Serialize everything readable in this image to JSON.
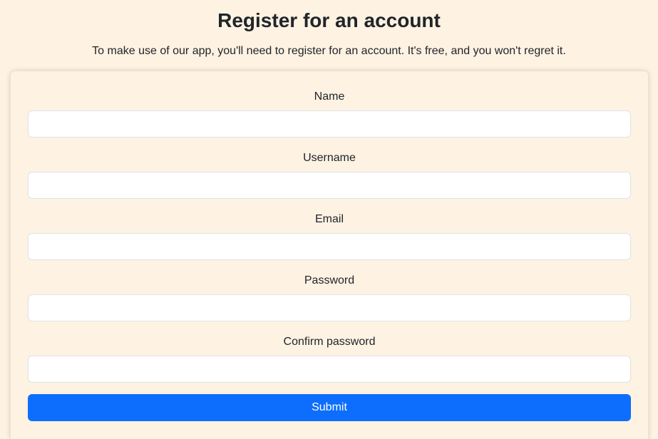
{
  "page": {
    "title": "Register for an account",
    "subtitle": "To make use of our app, you'll need to register for an account. It's free, and you won't regret it."
  },
  "form": {
    "fields": [
      {
        "label": "Name",
        "value": "",
        "placeholder": ""
      },
      {
        "label": "Username",
        "value": "",
        "placeholder": ""
      },
      {
        "label": "Email",
        "value": "",
        "placeholder": ""
      },
      {
        "label": "Password",
        "value": "",
        "placeholder": ""
      },
      {
        "label": "Confirm password",
        "value": "",
        "placeholder": ""
      }
    ],
    "submit_label": "Submit"
  },
  "colors": {
    "background": "#fef2e3",
    "input_background": "#ffffff",
    "input_border": "#dee2e6",
    "primary": "#0d6efd",
    "text": "#212529"
  }
}
